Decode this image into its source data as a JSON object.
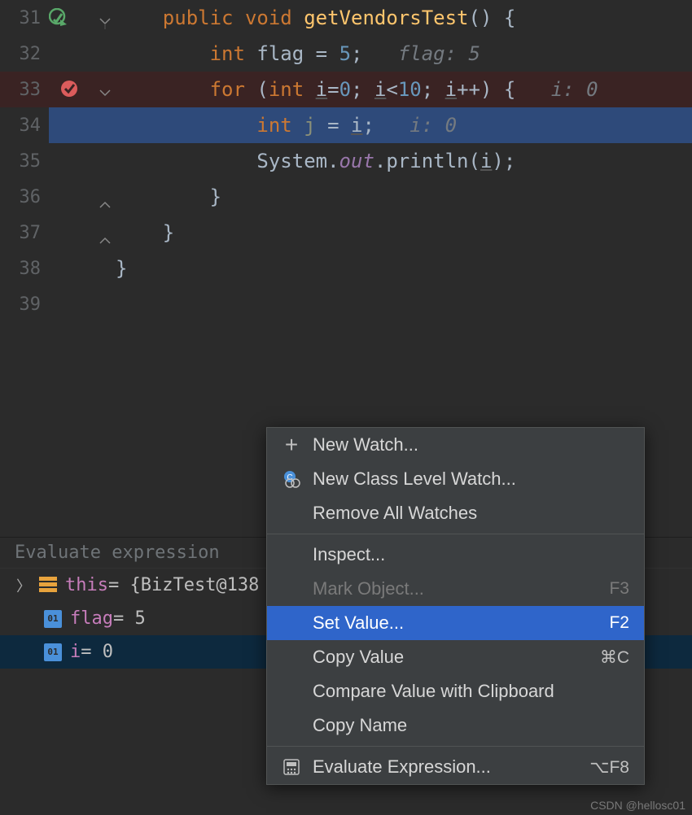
{
  "editor": {
    "lines": [
      {
        "num": "31",
        "run_icon": true
      },
      {
        "num": "32",
        "hint": "flag: 5"
      },
      {
        "num": "33",
        "break_icon": true,
        "hint": "i: 0"
      },
      {
        "num": "34",
        "current": true,
        "hint": "i: 0"
      },
      {
        "num": "35"
      },
      {
        "num": "36"
      },
      {
        "num": "37"
      },
      {
        "num": "38"
      },
      {
        "num": "39"
      }
    ],
    "tokens": {
      "kw_public": "public",
      "kw_void": "void",
      "method": "getVendorsTest",
      "kw_int": "int",
      "flag_var": "flag",
      "five": "5",
      "kw_for": "for",
      "i_var": "i",
      "zero": "0",
      "ten": "10",
      "plusplus": "++",
      "j_var": "j",
      "system": "System",
      "out": "out",
      "println": "println",
      "hint_flag": "flag: 5",
      "hint_i": "i: 0"
    }
  },
  "watches": {
    "eval_placeholder": "Evaluate expression",
    "rows": [
      {
        "kind": "obj",
        "name": "this",
        "value": " = {BizTest@138"
      },
      {
        "kind": "prim",
        "name": "flag",
        "value": " = 5"
      },
      {
        "kind": "prim",
        "name": "i",
        "value": " = 0"
      }
    ]
  },
  "menu": {
    "items": [
      {
        "label": "New Watch...",
        "icon": "plus"
      },
      {
        "label": "New Class Level Watch...",
        "icon": "class"
      },
      {
        "label": "Remove All Watches"
      }
    ],
    "items2": [
      {
        "label": "Inspect..."
      },
      {
        "label": "Mark Object...",
        "shortcut": "F3",
        "disabled": true
      },
      {
        "label": "Set Value...",
        "shortcut": "F2",
        "selected": true
      },
      {
        "label": "Copy Value",
        "shortcut": "⌘C"
      },
      {
        "label": "Compare Value with Clipboard"
      },
      {
        "label": "Copy Name"
      }
    ],
    "items3": [
      {
        "label": "Evaluate Expression...",
        "shortcut": "⌥F8",
        "icon": "calc"
      }
    ]
  },
  "watermark": "CSDN @hellosc01"
}
